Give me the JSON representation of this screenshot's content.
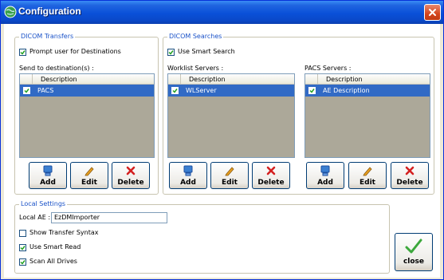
{
  "window": {
    "title": "Configuration",
    "icons": {
      "app": "globe-icon",
      "close": "close-icon"
    }
  },
  "dicom_transfers": {
    "legend": "DICOM Transfers",
    "prompt_checkbox": {
      "label": "Prompt user for Destinations",
      "checked": true
    },
    "list_label": "Send to destination(s) :",
    "column_header": "Description",
    "items": [
      {
        "label": "PACS",
        "checked": true
      }
    ],
    "buttons": {
      "add": "Add",
      "edit": "Edit",
      "delete": "Delete"
    }
  },
  "dicom_searches": {
    "legend": "DICOM Searches",
    "smart_search_checkbox": {
      "label": "Use Smart Search",
      "checked": true
    },
    "worklist": {
      "label": "Worklist Servers :",
      "column_header": "Description",
      "items": [
        {
          "label": "WLServer",
          "checked": true
        }
      ],
      "buttons": {
        "add": "Add",
        "edit": "Edit",
        "delete": "Delete"
      }
    },
    "pacs": {
      "label": "PACS Servers :",
      "column_header": "Description",
      "items": [
        {
          "label": "AE Description",
          "checked": true
        }
      ],
      "buttons": {
        "add": "Add",
        "edit": "Edit",
        "delete": "Delete"
      }
    }
  },
  "local_settings": {
    "legend": "Local Settings",
    "local_ae_label": "Local AE :",
    "local_ae_value": "EzDMImporter",
    "show_transfer_syntax": {
      "label": "Show Transfer Syntax",
      "checked": false
    },
    "use_smart_read": {
      "label": "Use Smart Read",
      "checked": true
    },
    "scan_all_drives": {
      "label": "Scan All Drives",
      "checked": true
    }
  },
  "close_button": {
    "label": "close"
  },
  "colors": {
    "titlebar": "#0a50d8",
    "selection": "#316ac5",
    "legend": "#1a52c8",
    "add_icon": "#3b7fd1",
    "edit_icon": "#e8a020",
    "delete_icon": "#d42020",
    "close_check": "#3ca83c"
  }
}
